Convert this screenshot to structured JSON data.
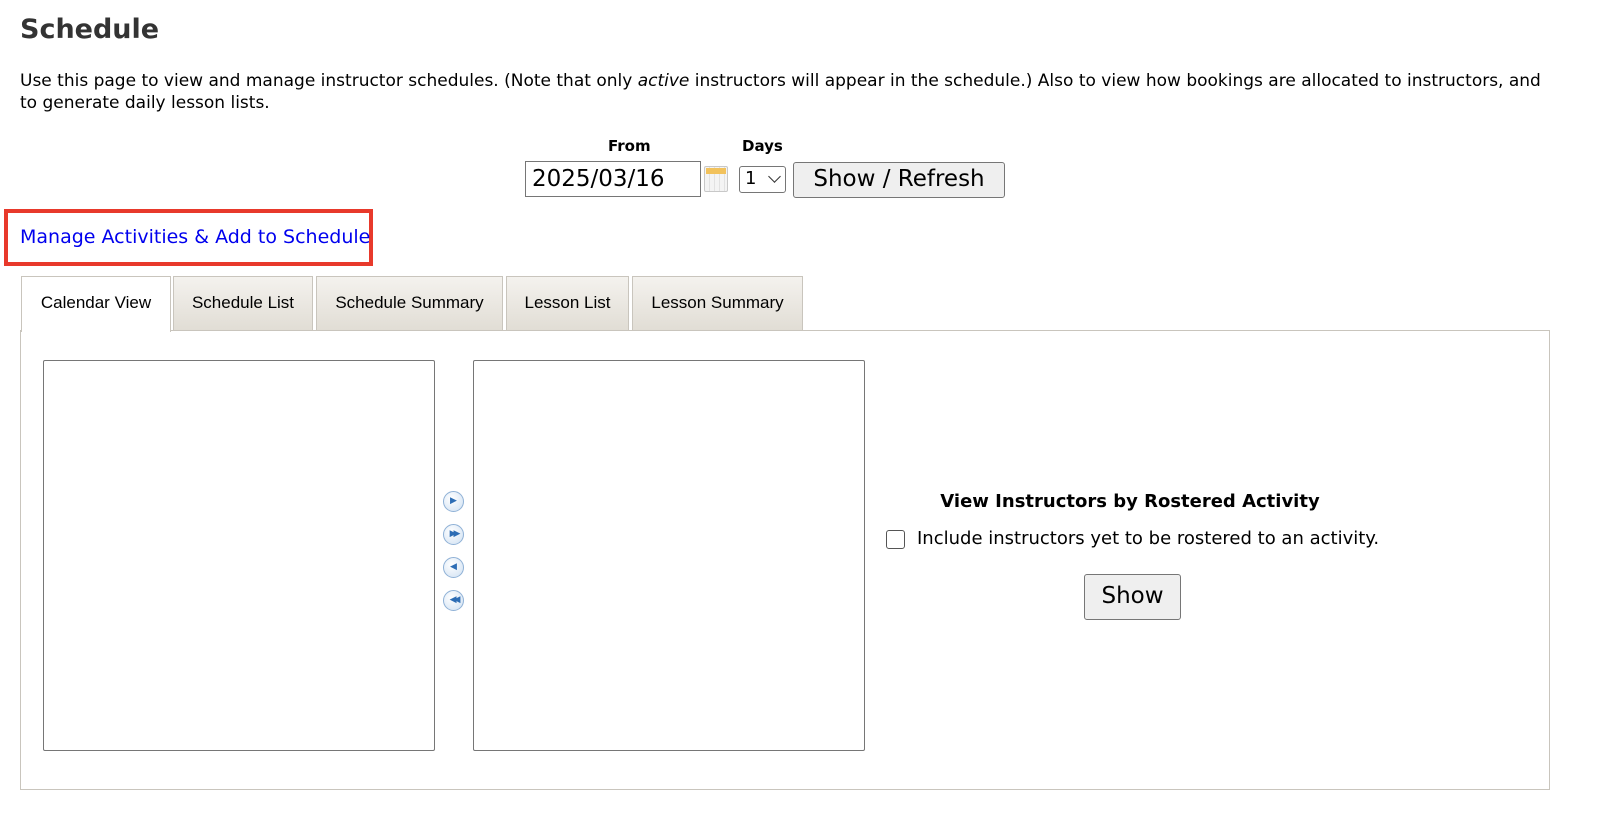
{
  "page": {
    "title": "Schedule",
    "intro_before": "Use this page to view and manage instructor schedules. (Note that only ",
    "intro_em": "active",
    "intro_after": " instructors will appear in the schedule.) Also to view how bookings are allocated to instructors, and to generate daily lesson lists."
  },
  "controls": {
    "from_label": "From",
    "days_label": "Days",
    "from_value": "2025/03/16",
    "days_value": "1",
    "calendar_icon": "calendar-icon",
    "refresh_label": "Show / Refresh"
  },
  "manage_link": {
    "label": "Manage Activities & Add to Schedule",
    "highlight_color": "#e8392b"
  },
  "tabs": [
    {
      "label": "Calendar View",
      "active": true
    },
    {
      "label": "Schedule List",
      "active": false
    },
    {
      "label": "Schedule Summary",
      "active": false
    },
    {
      "label": "Lesson List",
      "active": false
    },
    {
      "label": "Lesson Summary",
      "active": false
    }
  ],
  "calendar_view": {
    "move_buttons": [
      {
        "icon": "move-right-icon",
        "glyph": "▶"
      },
      {
        "icon": "move-all-right-icon",
        "glyph": "▶▶"
      },
      {
        "icon": "move-left-icon",
        "glyph": "◀"
      },
      {
        "icon": "move-all-left-icon",
        "glyph": "◀◀"
      }
    ],
    "roster_heading": "View Instructors by Rostered Activity",
    "include_label": "Include instructors yet to be rostered to an activity.",
    "include_checked": false,
    "show_label": "Show"
  },
  "colors": {
    "link": "#0000ee",
    "highlight": "#e8392b",
    "title": "#333333"
  }
}
